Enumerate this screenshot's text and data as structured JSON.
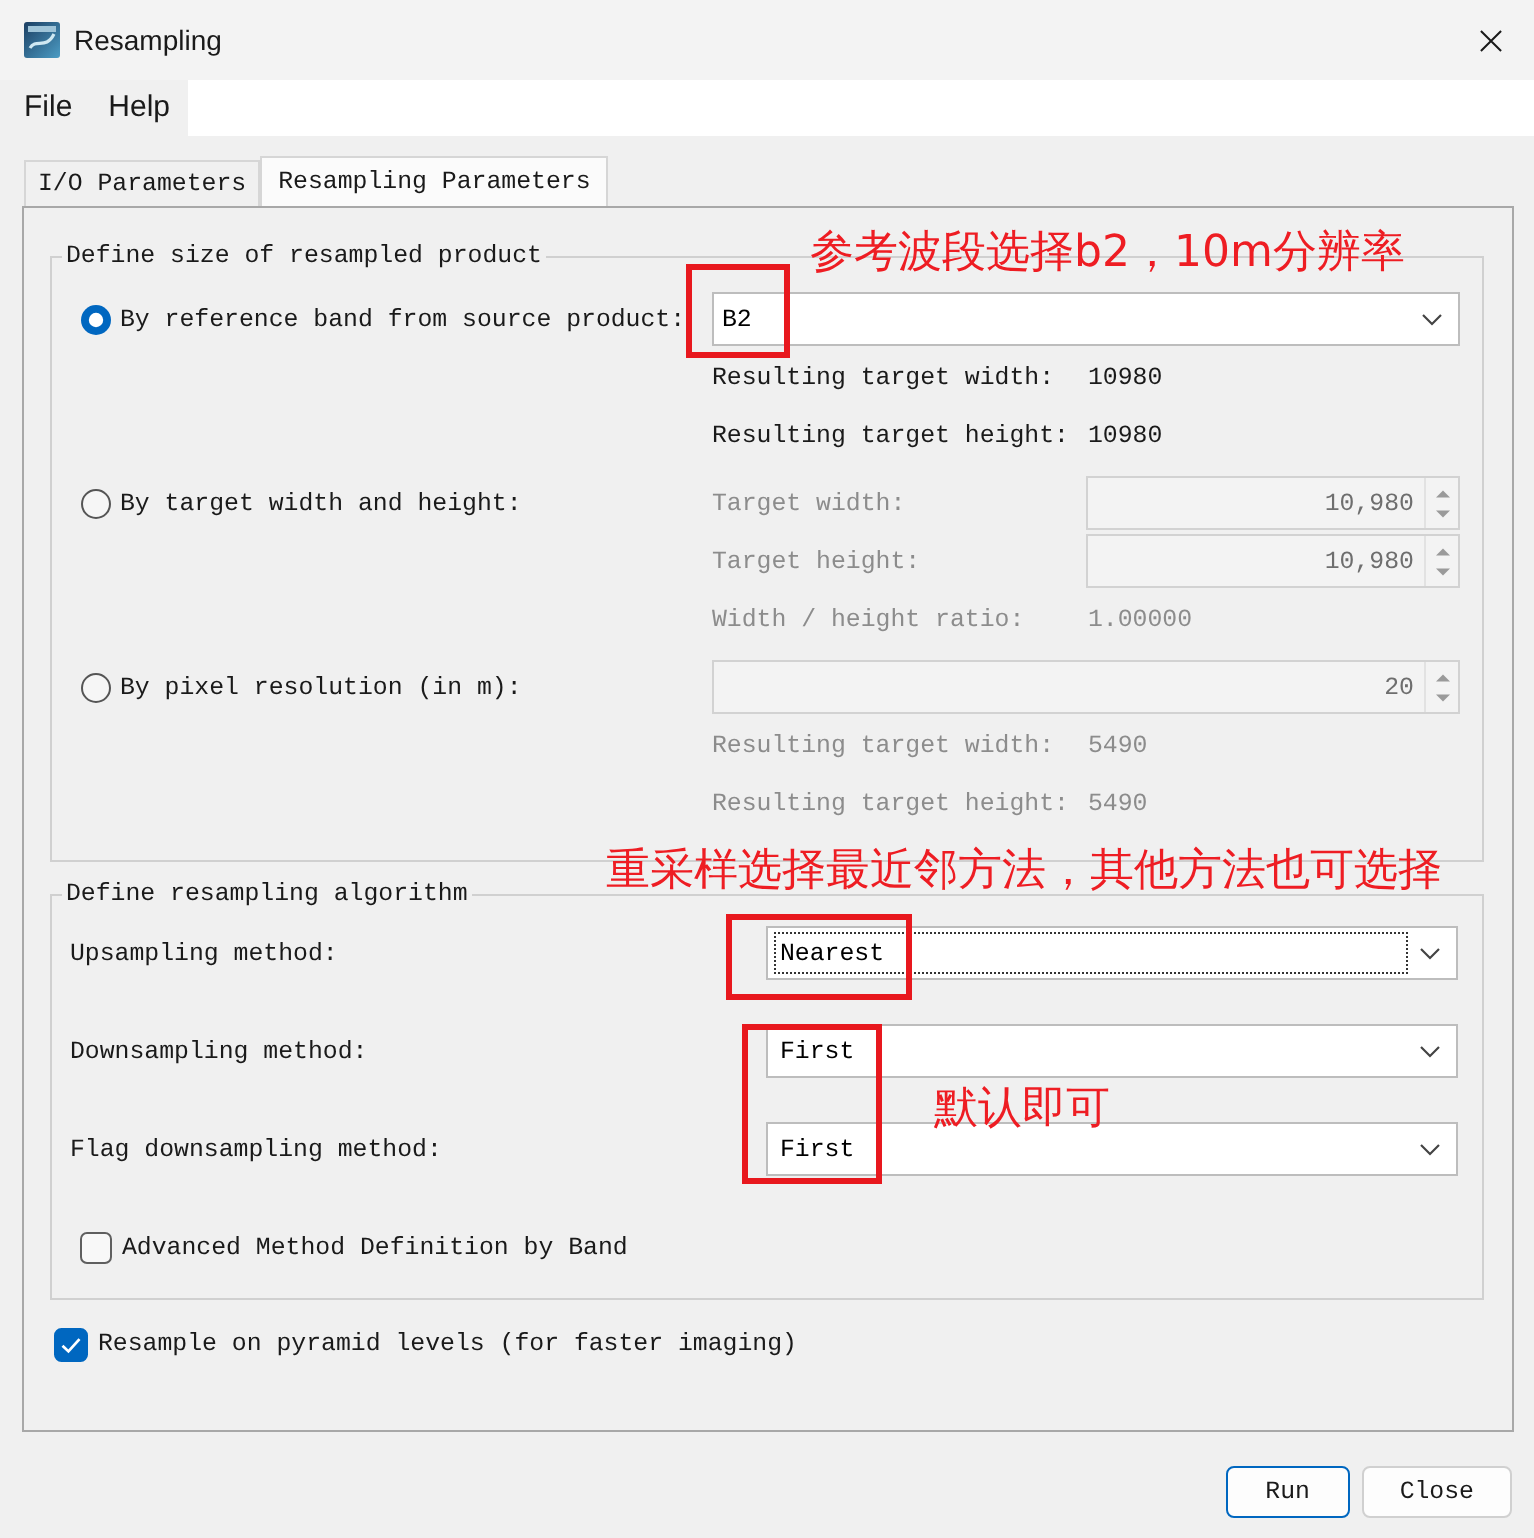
{
  "window": {
    "title": "Resampling"
  },
  "menu": [
    "File",
    "Help"
  ],
  "tabs": [
    {
      "label": "I/O Parameters",
      "selected": false
    },
    {
      "label": "Resampling Parameters",
      "selected": true
    }
  ],
  "size_group": {
    "title": "Define size of resampled product",
    "options": [
      {
        "label": "By reference band from source product:",
        "selected": true,
        "lines": [
          {
            "kind": "combo",
            "value": "B2",
            "disabled": false
          },
          {
            "kind": "info",
            "label": "Resulting target width:",
            "value": "10980",
            "disabled": false
          },
          {
            "kind": "info",
            "label": "Resulting target height:",
            "value": "10980",
            "disabled": false
          }
        ]
      },
      {
        "label": "By target width and height:",
        "selected": false,
        "lines": [
          {
            "kind": "spinner",
            "label": "Target width:",
            "value": "10,980",
            "disabled": true
          },
          {
            "kind": "spinner",
            "label": "Target height:",
            "value": "10,980",
            "disabled": true
          },
          {
            "kind": "info",
            "label": "Width / height ratio:",
            "value": "1.00000",
            "disabled": true
          }
        ]
      },
      {
        "label": "By pixel resolution (in m):",
        "selected": false,
        "lines": [
          {
            "kind": "spinner",
            "value": "20",
            "disabled": true
          },
          {
            "kind": "info",
            "label": "Resulting target width:",
            "value": "5490",
            "disabled": true
          },
          {
            "kind": "info",
            "label": "Resulting target height:",
            "value": "5490",
            "disabled": true
          }
        ]
      }
    ]
  },
  "algorithm_group": {
    "title": "Define resampling algorithm",
    "methods": [
      {
        "label": "Upsampling method:",
        "value": "Nearest",
        "focused": true
      },
      {
        "label": "Downsampling method:",
        "value": "First",
        "focused": false
      },
      {
        "label": "Flag downsampling method:",
        "value": "First",
        "focused": false
      }
    ],
    "advanced": {
      "label": "Advanced Method Definition by Band",
      "checked": false
    }
  },
  "pyramid": {
    "label": "Resample on pyramid levels (for faster imaging)",
    "checked": true
  },
  "buttons": [
    {
      "label": "Run",
      "default": true
    },
    {
      "label": "Close",
      "default": false
    }
  ],
  "annotations": [
    {
      "text": "参考波段选择b2，10m分辨率"
    },
    {
      "text": "重采样选择最近邻方法，其他方法也可选择"
    },
    {
      "text": "默认即可"
    }
  ]
}
